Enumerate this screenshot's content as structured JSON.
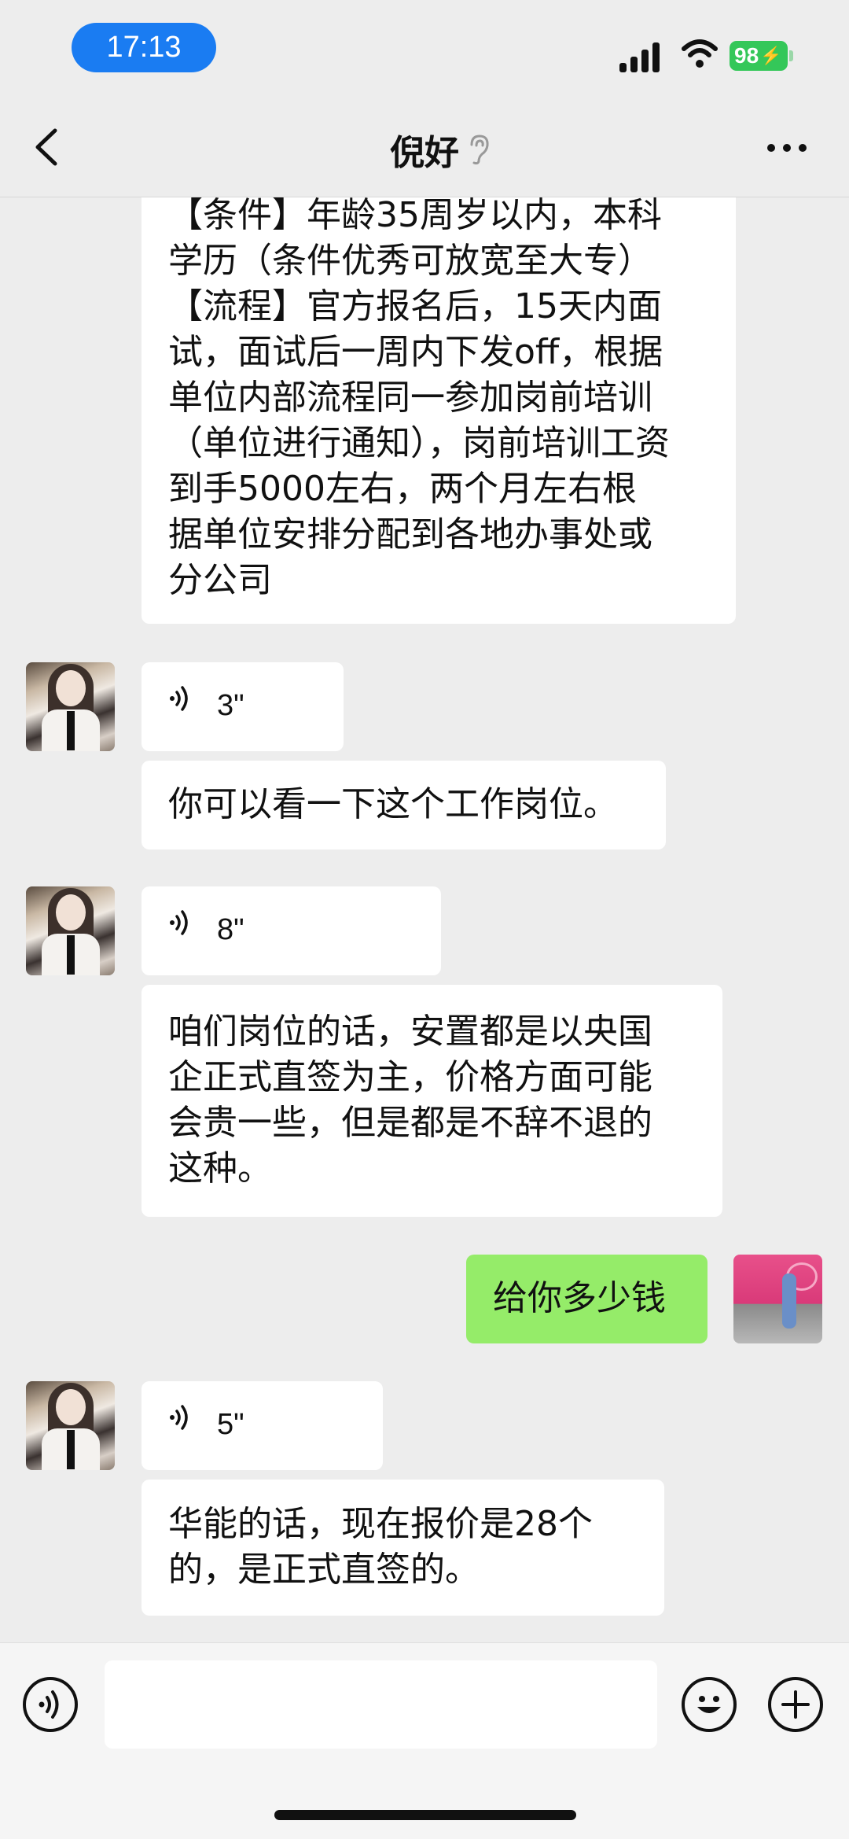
{
  "status_bar": {
    "time": "17:13",
    "battery": "98"
  },
  "header": {
    "title": "倪好"
  },
  "messages": {
    "m0": {
      "lines": [
        "【条件】年龄35周岁以内，本科",
        "学历（条件优秀可放宽至大专）",
        "【流程】官方报名后，15天内面",
        "试，面试后一周内下发off，根据",
        "单位内部流程同一参加岗前培训",
        "（单位进行通知），岗前培训工资",
        "到手5000左右，两个月左右根",
        "据单位安排分配到各地办事处或",
        "分公司"
      ]
    },
    "m1": {
      "type": "voice",
      "duration": "3\""
    },
    "m2": {
      "lines": [
        "你可以看一下这个工作岗位。"
      ]
    },
    "m3": {
      "type": "voice",
      "duration": "8\""
    },
    "m4": {
      "lines": [
        "咱们岗位的话，安置都是以央国",
        "企正式直签为主，价格方面可能",
        "会贵一些，但是都是不辞不退的",
        "这种。"
      ]
    },
    "m5": {
      "lines": [
        "给你多少钱"
      ],
      "sender": "me"
    },
    "m6": {
      "type": "voice",
      "duration": "5\""
    },
    "m7": {
      "lines": [
        "华能的话，现在报价是28个",
        "的，是正式直签的。"
      ]
    }
  },
  "colors": {
    "accent_green": "#95ec69",
    "time_pill": "#1a7cf2",
    "battery": "#34c759"
  },
  "icons": [
    "back-arrow-icon",
    "ear-icon",
    "more-dots-icon",
    "voice-wave-icon",
    "voice-input-icon",
    "emoji-icon",
    "plus-icon"
  ]
}
